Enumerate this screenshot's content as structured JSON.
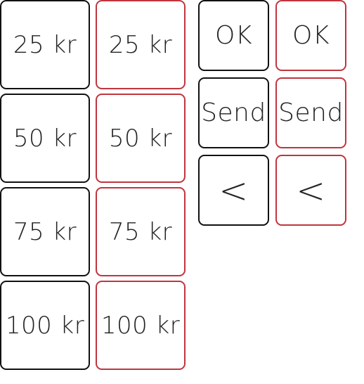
{
  "colors": {
    "black_border": "#111111",
    "red_border": "#c0353f",
    "text": "#222222",
    "background": "#ffffff"
  },
  "amounts": {
    "black": [
      "25 kr",
      "50 kr",
      "75 kr",
      "100 kr"
    ],
    "red": [
      "25 kr",
      "50 kr",
      "75 kr",
      "100 kr"
    ]
  },
  "actions": {
    "black": [
      "OK",
      "Send",
      "<"
    ],
    "red": [
      "OK",
      "Send",
      "<"
    ]
  }
}
